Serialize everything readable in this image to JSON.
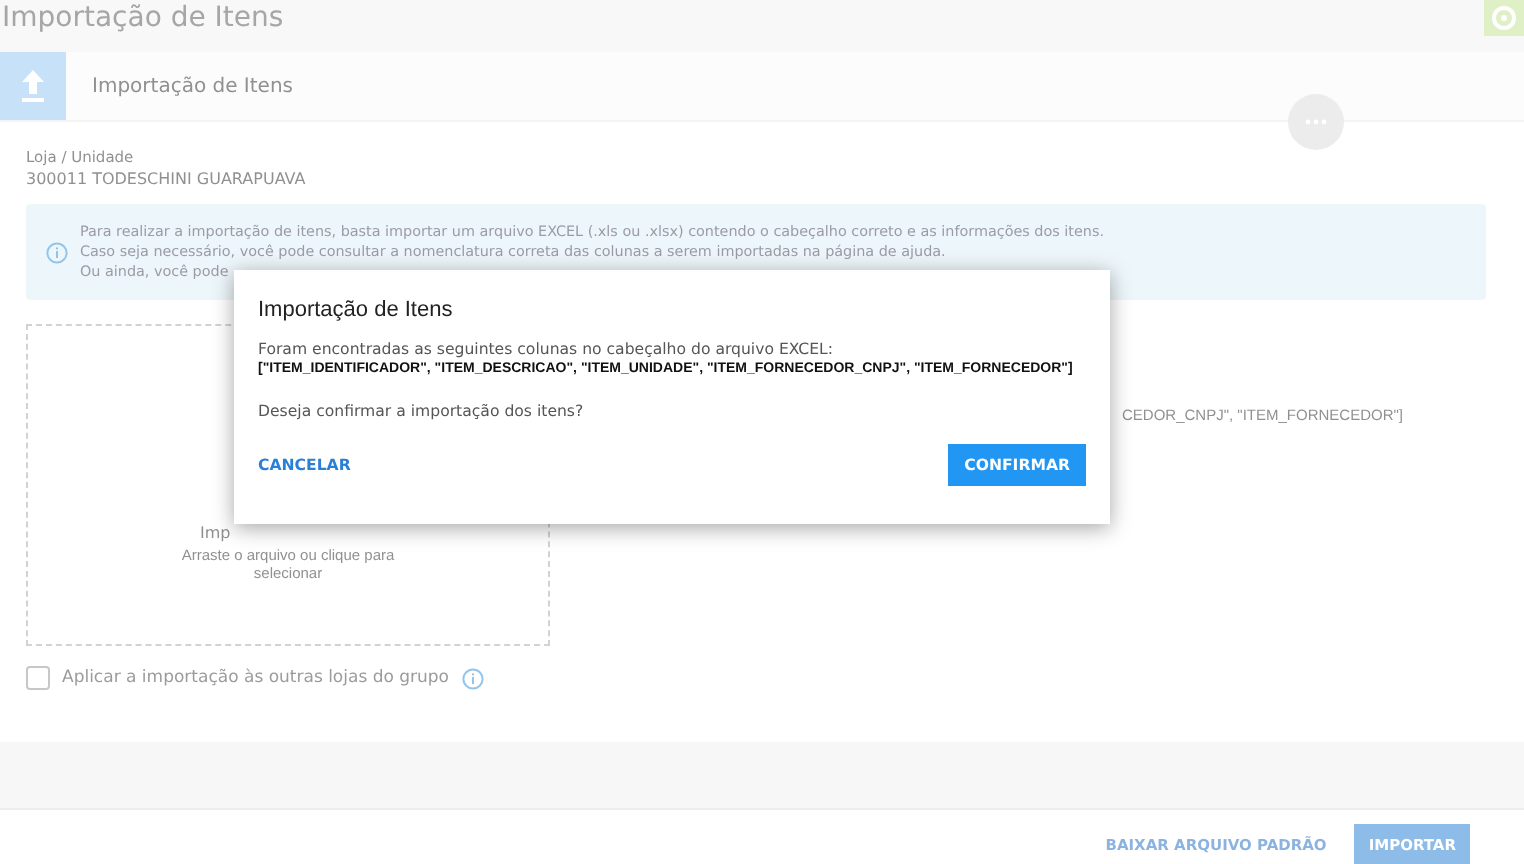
{
  "page_title": "Importação de Itens",
  "header": {
    "title": "Importação de Itens"
  },
  "store": {
    "label": "Loja / Unidade",
    "value": "300011 TODESCHINI GUARAPUAVA"
  },
  "info": {
    "lines": [
      "Para realizar a importação de itens, basta importar um arquivo EXCEL (.xls ou .xlsx) contendo o cabeçalho correto e as informações dos itens.",
      "Caso seja necessário, você pode consultar a nomenclatura correta das colunas a serem importadas na página de ajuda.",
      "Ou ainda, você pode"
    ]
  },
  "dropzone": {
    "title": "Imp",
    "hint": "Arraste o arquivo ou clique para selecionar"
  },
  "background_text": "CEDOR_CNPJ\", \"ITEM_FORNECEDOR\"]",
  "checkbox": {
    "label": "Aplicar a importação às outras lojas do grupo",
    "checked": false
  },
  "footer_buttons": [
    {
      "label": "BAIXAR ARQUIVO PADRÃO",
      "kind": "text",
      "disabled": true
    },
    {
      "label": "IMPORTAR",
      "kind": "filled",
      "disabled": true
    }
  ],
  "dialog": {
    "title": "Importação de Itens",
    "message": "Foram encontradas as seguintes colunas no cabeçalho do arquivo EXCEL:",
    "columns": "[\"ITEM_IDENTIFICADOR\", \"ITEM_DESCRICAO\", \"ITEM_UNIDADE\", \"ITEM_FORNECEDOR_CNPJ\", \"ITEM_FORNECEDOR\"]",
    "question": "Deseja confirmar a importação dos itens?",
    "buttons": [
      {
        "label": "CANCELAR",
        "kind": "text"
      },
      {
        "label": "CONFIRMAR",
        "kind": "filled"
      }
    ]
  }
}
